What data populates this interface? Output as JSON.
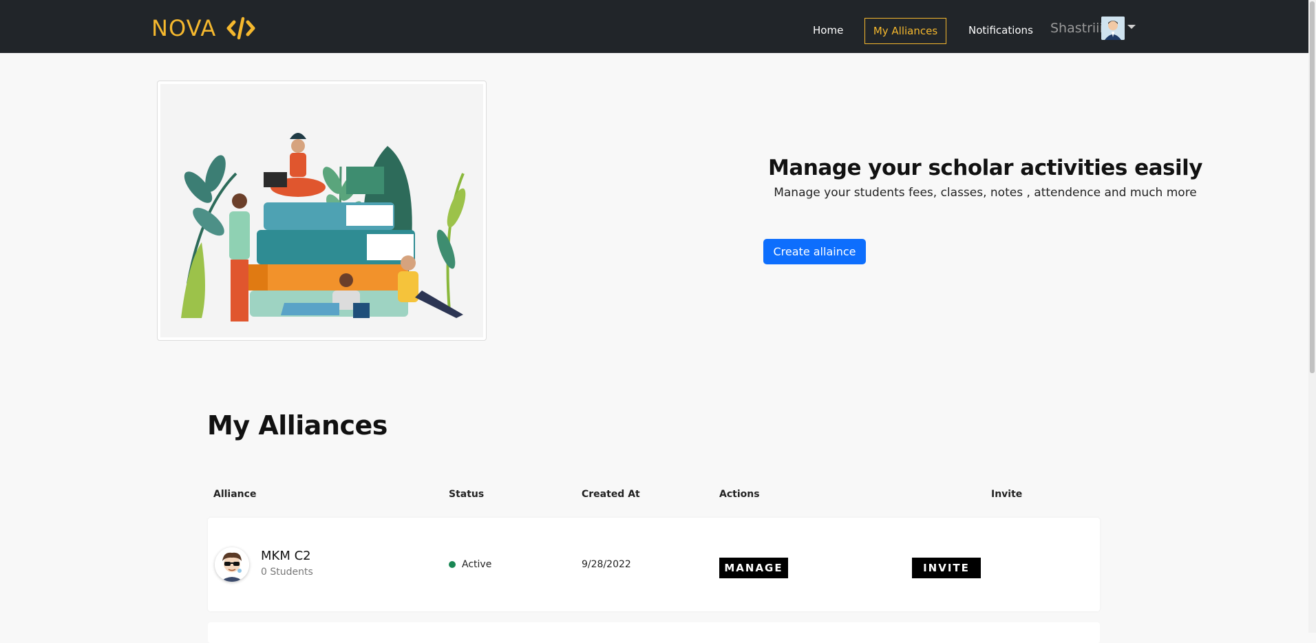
{
  "nav": {
    "brand": "NOVA",
    "brand_icon": "code-icon",
    "links": {
      "home": "Home",
      "alliances": "My Alliances",
      "notifications": "Notifications"
    },
    "user_name": "Shastriii",
    "accent": "#f5b82e"
  },
  "hero": {
    "title": "Manage your scholar activities easily",
    "subtitle": "Manage your students fees, classes, notes , attendence and much more",
    "create_button": "Create allaince",
    "button_color": "#0d6efd"
  },
  "alliances": {
    "title": "My Alliances",
    "columns": [
      "Alliance",
      "Status",
      "Created At",
      "Actions",
      "Invite"
    ],
    "rows": [
      {
        "name": "MKM C2",
        "students": "0 Students",
        "status": "Active",
        "status_color": "#198754",
        "created_at": "9/28/2022",
        "action_label": "MANAGE",
        "invite_label": "INVITE"
      }
    ]
  }
}
